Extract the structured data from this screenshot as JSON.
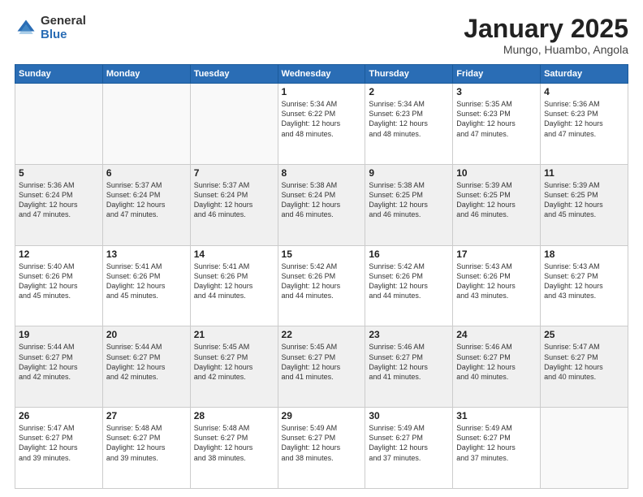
{
  "logo": {
    "general": "General",
    "blue": "Blue"
  },
  "title": {
    "month": "January 2025",
    "location": "Mungo, Huambo, Angola"
  },
  "weekdays": [
    "Sunday",
    "Monday",
    "Tuesday",
    "Wednesday",
    "Thursday",
    "Friday",
    "Saturday"
  ],
  "weeks": [
    [
      {
        "day": "",
        "info": ""
      },
      {
        "day": "",
        "info": ""
      },
      {
        "day": "",
        "info": ""
      },
      {
        "day": "1",
        "info": "Sunrise: 5:34 AM\nSunset: 6:22 PM\nDaylight: 12 hours\nand 48 minutes."
      },
      {
        "day": "2",
        "info": "Sunrise: 5:34 AM\nSunset: 6:23 PM\nDaylight: 12 hours\nand 48 minutes."
      },
      {
        "day": "3",
        "info": "Sunrise: 5:35 AM\nSunset: 6:23 PM\nDaylight: 12 hours\nand 47 minutes."
      },
      {
        "day": "4",
        "info": "Sunrise: 5:36 AM\nSunset: 6:23 PM\nDaylight: 12 hours\nand 47 minutes."
      }
    ],
    [
      {
        "day": "5",
        "info": "Sunrise: 5:36 AM\nSunset: 6:24 PM\nDaylight: 12 hours\nand 47 minutes."
      },
      {
        "day": "6",
        "info": "Sunrise: 5:37 AM\nSunset: 6:24 PM\nDaylight: 12 hours\nand 47 minutes."
      },
      {
        "day": "7",
        "info": "Sunrise: 5:37 AM\nSunset: 6:24 PM\nDaylight: 12 hours\nand 46 minutes."
      },
      {
        "day": "8",
        "info": "Sunrise: 5:38 AM\nSunset: 6:24 PM\nDaylight: 12 hours\nand 46 minutes."
      },
      {
        "day": "9",
        "info": "Sunrise: 5:38 AM\nSunset: 6:25 PM\nDaylight: 12 hours\nand 46 minutes."
      },
      {
        "day": "10",
        "info": "Sunrise: 5:39 AM\nSunset: 6:25 PM\nDaylight: 12 hours\nand 46 minutes."
      },
      {
        "day": "11",
        "info": "Sunrise: 5:39 AM\nSunset: 6:25 PM\nDaylight: 12 hours\nand 45 minutes."
      }
    ],
    [
      {
        "day": "12",
        "info": "Sunrise: 5:40 AM\nSunset: 6:26 PM\nDaylight: 12 hours\nand 45 minutes."
      },
      {
        "day": "13",
        "info": "Sunrise: 5:41 AM\nSunset: 6:26 PM\nDaylight: 12 hours\nand 45 minutes."
      },
      {
        "day": "14",
        "info": "Sunrise: 5:41 AM\nSunset: 6:26 PM\nDaylight: 12 hours\nand 44 minutes."
      },
      {
        "day": "15",
        "info": "Sunrise: 5:42 AM\nSunset: 6:26 PM\nDaylight: 12 hours\nand 44 minutes."
      },
      {
        "day": "16",
        "info": "Sunrise: 5:42 AM\nSunset: 6:26 PM\nDaylight: 12 hours\nand 44 minutes."
      },
      {
        "day": "17",
        "info": "Sunrise: 5:43 AM\nSunset: 6:26 PM\nDaylight: 12 hours\nand 43 minutes."
      },
      {
        "day": "18",
        "info": "Sunrise: 5:43 AM\nSunset: 6:27 PM\nDaylight: 12 hours\nand 43 minutes."
      }
    ],
    [
      {
        "day": "19",
        "info": "Sunrise: 5:44 AM\nSunset: 6:27 PM\nDaylight: 12 hours\nand 42 minutes."
      },
      {
        "day": "20",
        "info": "Sunrise: 5:44 AM\nSunset: 6:27 PM\nDaylight: 12 hours\nand 42 minutes."
      },
      {
        "day": "21",
        "info": "Sunrise: 5:45 AM\nSunset: 6:27 PM\nDaylight: 12 hours\nand 42 minutes."
      },
      {
        "day": "22",
        "info": "Sunrise: 5:45 AM\nSunset: 6:27 PM\nDaylight: 12 hours\nand 41 minutes."
      },
      {
        "day": "23",
        "info": "Sunrise: 5:46 AM\nSunset: 6:27 PM\nDaylight: 12 hours\nand 41 minutes."
      },
      {
        "day": "24",
        "info": "Sunrise: 5:46 AM\nSunset: 6:27 PM\nDaylight: 12 hours\nand 40 minutes."
      },
      {
        "day": "25",
        "info": "Sunrise: 5:47 AM\nSunset: 6:27 PM\nDaylight: 12 hours\nand 40 minutes."
      }
    ],
    [
      {
        "day": "26",
        "info": "Sunrise: 5:47 AM\nSunset: 6:27 PM\nDaylight: 12 hours\nand 39 minutes."
      },
      {
        "day": "27",
        "info": "Sunrise: 5:48 AM\nSunset: 6:27 PM\nDaylight: 12 hours\nand 39 minutes."
      },
      {
        "day": "28",
        "info": "Sunrise: 5:48 AM\nSunset: 6:27 PM\nDaylight: 12 hours\nand 38 minutes."
      },
      {
        "day": "29",
        "info": "Sunrise: 5:49 AM\nSunset: 6:27 PM\nDaylight: 12 hours\nand 38 minutes."
      },
      {
        "day": "30",
        "info": "Sunrise: 5:49 AM\nSunset: 6:27 PM\nDaylight: 12 hours\nand 37 minutes."
      },
      {
        "day": "31",
        "info": "Sunrise: 5:49 AM\nSunset: 6:27 PM\nDaylight: 12 hours\nand 37 minutes."
      },
      {
        "day": "",
        "info": ""
      }
    ]
  ]
}
